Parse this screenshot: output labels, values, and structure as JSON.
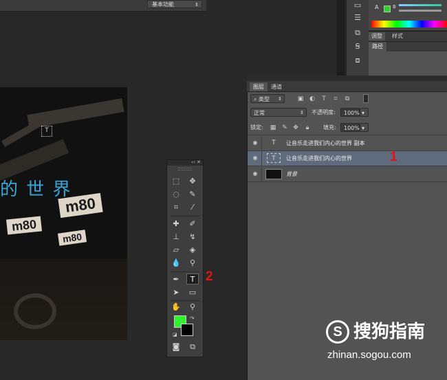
{
  "top_bar": {
    "workspace_label": "基本功能"
  },
  "color_panel": {
    "letter_b": "B",
    "letter_a": "A"
  },
  "adjust_tabs": [
    "调整",
    "样式"
  ],
  "paths_tab": "路径",
  "canvas": {
    "headline": "的 世 界",
    "signs": [
      "m80",
      "m80",
      "m80"
    ]
  },
  "layers_panel": {
    "tabs": [
      "图层",
      "通道"
    ],
    "filter_kind": "类型",
    "blend_mode": "正常",
    "opacity_label": "不透明度:",
    "opacity_value": "100%",
    "lock_label": "锁定:",
    "fill_label": "填充:",
    "fill_value": "100%",
    "layers": [
      {
        "name": "让音乐走进我们内心的世界 副本",
        "kind": "text",
        "selected": false
      },
      {
        "name": "让音乐走进我们内心的世界",
        "kind": "text",
        "selected": true
      },
      {
        "name": "背景",
        "kind": "image",
        "selected": false
      }
    ]
  },
  "callouts": {
    "one": "1",
    "two": "2"
  },
  "watermark": {
    "logo": "S",
    "brand": "搜狗指南",
    "url": "zhinan.sogou.com"
  },
  "colors": {
    "foreground": "#2ef02e",
    "background": "#000000",
    "text_color": "#36a6d9",
    "selected_row": "#5f6a7c"
  }
}
